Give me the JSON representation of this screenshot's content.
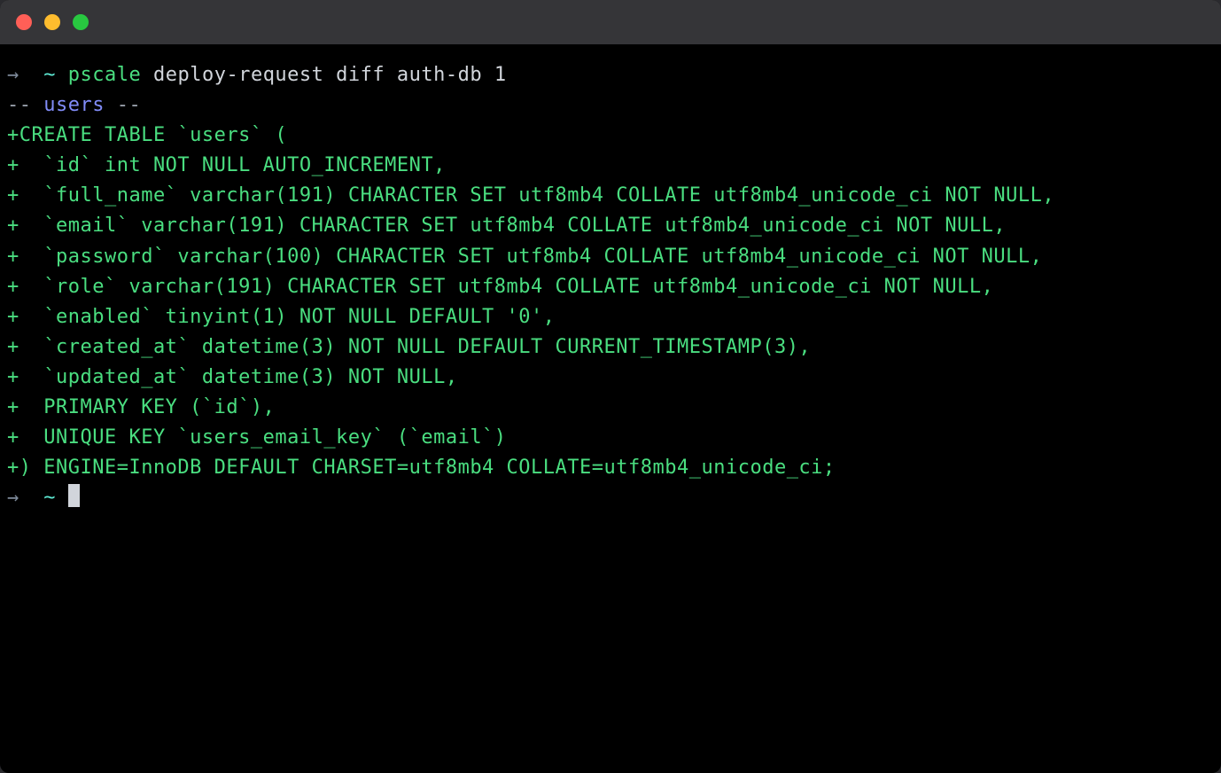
{
  "prompt": {
    "arrow": "→",
    "tilde": "~",
    "command_name": "pscale",
    "command_args": "deploy-request diff auth-db 1"
  },
  "header_line": {
    "dashes_prefix": "-- ",
    "label": "users",
    "dashes_suffix": " --"
  },
  "diff_lines": [
    "+CREATE TABLE `users` (",
    "+  `id` int NOT NULL AUTO_INCREMENT,",
    "+  `full_name` varchar(191) CHARACTER SET utf8mb4 COLLATE utf8mb4_unicode_ci NOT NULL,",
    "+  `email` varchar(191) CHARACTER SET utf8mb4 COLLATE utf8mb4_unicode_ci NOT NULL,",
    "+  `password` varchar(100) CHARACTER SET utf8mb4 COLLATE utf8mb4_unicode_ci NOT NULL,",
    "+  `role` varchar(191) CHARACTER SET utf8mb4 COLLATE utf8mb4_unicode_ci NOT NULL,",
    "+  `enabled` tinyint(1) NOT NULL DEFAULT '0',",
    "+  `created_at` datetime(3) NOT NULL DEFAULT CURRENT_TIMESTAMP(3),",
    "+  `updated_at` datetime(3) NOT NULL,",
    "+  PRIMARY KEY (`id`),",
    "+  UNIQUE KEY `users_email_key` (`email`)",
    "+) ENGINE=InnoDB DEFAULT CHARSET=utf8mb4 COLLATE=utf8mb4_unicode_ci;"
  ],
  "prompt2": {
    "arrow": "→",
    "tilde": "~"
  }
}
